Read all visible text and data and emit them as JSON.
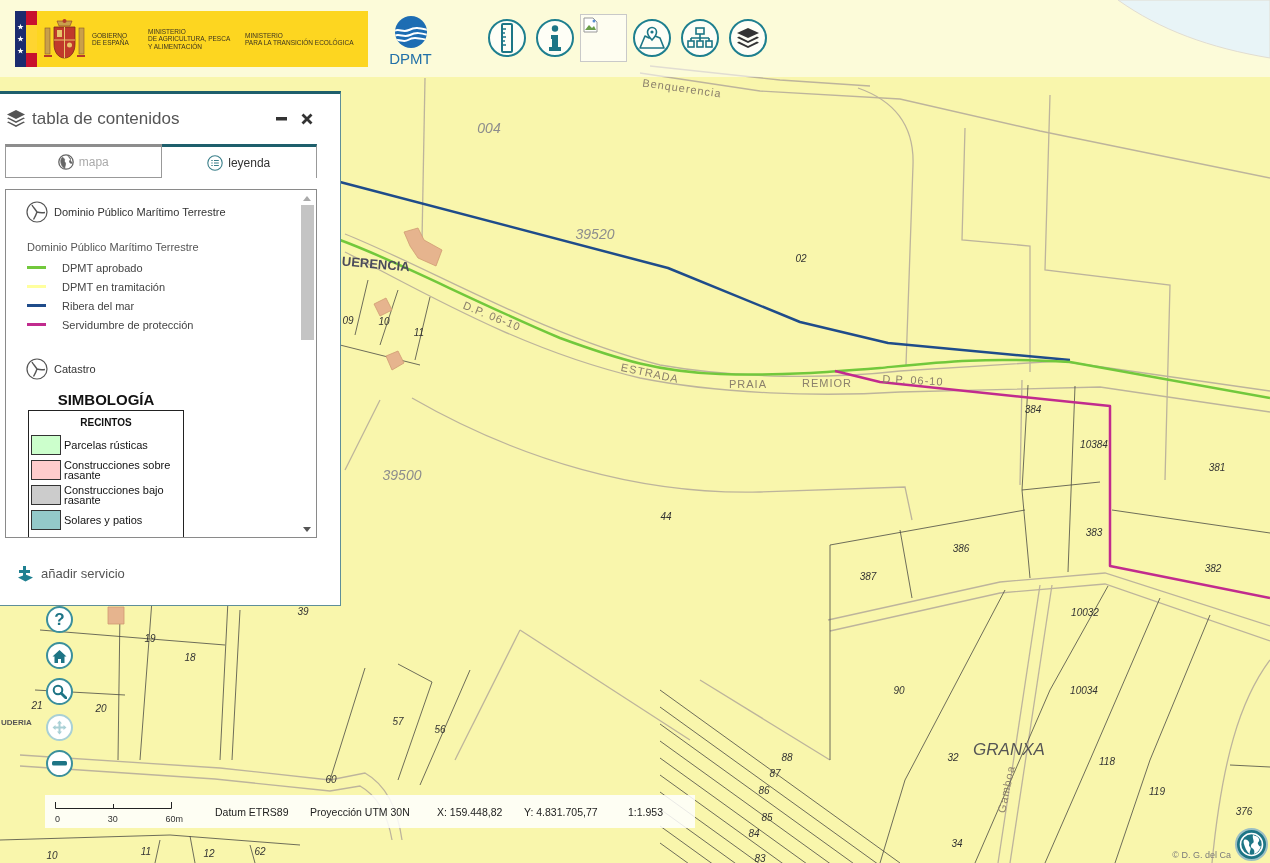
{
  "header": {
    "logo_texts": [
      [
        "GOBIERNO",
        "DE ESPAÑA"
      ],
      [
        "MINISTERIO",
        "DE AGRICULTURA, PESCA",
        "Y ALIMENTACIÓN"
      ],
      [
        "MINISTERIO",
        "PARA LA TRANSICIÓN ECOLÓGICA"
      ]
    ],
    "dpmt_label": "DPMT"
  },
  "panel": {
    "title": "tabla de contenidos",
    "tabs": [
      {
        "label": "mapa",
        "selected": false
      },
      {
        "label": "leyenda",
        "selected": true
      }
    ],
    "services": [
      {
        "kind": "lines",
        "name": "Dominio Público Marítimo Terrestre",
        "layer_title": "Dominio Público Marítimo Terrestre",
        "entries": [
          {
            "label": "DPMT aprobado",
            "color": "#72c83c"
          },
          {
            "label": "DPMT en tramitación",
            "color": "#ffff9e"
          },
          {
            "label": "Ribera del mar",
            "color": "#1f4c8a"
          },
          {
            "label": "Servidumbre de protección",
            "color": "#c12b8e"
          }
        ]
      },
      {
        "kind": "table",
        "name": "Catastro",
        "title": "SIMBOLOGÍA",
        "heading": "RECINTOS",
        "entries": [
          {
            "label": "Parcelas rústicas",
            "color": "#ccffcc"
          },
          {
            "label": "Construcciones sobre rasante",
            "color": "#ffcccc"
          },
          {
            "label": "Construcciones bajo rasante",
            "color": "#cccccc"
          },
          {
            "label": "Solares y patios",
            "color": "#93c8c8"
          }
        ]
      }
    ],
    "add_service": "añadir servicio"
  },
  "map_tools": [
    {
      "label": "?",
      "disabled": false
    },
    {
      "disabled": false
    },
    {
      "disabled": false
    },
    {
      "disabled": true
    },
    {
      "disabled": false
    }
  ],
  "status_bar": {
    "scale_labels": [
      "0",
      "30",
      "60m"
    ],
    "datum": "Datum ETRS89",
    "projection": "Proyección UTM 30N",
    "x": "X: 159.448,82",
    "y": "Y: 4.831.705,77",
    "scale": "1:1.953"
  },
  "map": {
    "labels": [
      {
        "text": "Benquerencia",
        "kind": "road"
      },
      {
        "text": "004",
        "kind": "block"
      },
      {
        "text": "39520",
        "kind": "block"
      },
      {
        "text": "02",
        "kind": "parcel"
      },
      {
        "text": "UERENCIA",
        "kind": "place"
      },
      {
        "text": "09",
        "kind": "parcel"
      },
      {
        "text": "10",
        "kind": "parcel"
      },
      {
        "text": "11",
        "kind": "parcel"
      },
      {
        "text": "D.P. 06-10",
        "kind": "road"
      },
      {
        "text": "ESTRADA",
        "kind": "road"
      },
      {
        "text": "PRAIA",
        "kind": "road"
      },
      {
        "text": "REMIOR",
        "kind": "road"
      },
      {
        "text": "D.P. 06-10",
        "kind": "road"
      },
      {
        "text": "384",
        "kind": "parcel"
      },
      {
        "text": "10384",
        "kind": "parcel"
      },
      {
        "text": "381",
        "kind": "parcel"
      },
      {
        "text": "39500",
        "kind": "block"
      },
      {
        "text": "44",
        "kind": "parcel"
      },
      {
        "text": "383",
        "kind": "parcel"
      },
      {
        "text": "386",
        "kind": "parcel"
      },
      {
        "text": "382",
        "kind": "parcel"
      },
      {
        "text": "387",
        "kind": "parcel"
      },
      {
        "text": "39",
        "kind": "parcel"
      },
      {
        "text": "10032",
        "kind": "parcel"
      },
      {
        "text": "19",
        "kind": "parcel"
      },
      {
        "text": "18",
        "kind": "parcel"
      },
      {
        "text": "90",
        "kind": "parcel"
      },
      {
        "text": "10034",
        "kind": "parcel"
      },
      {
        "text": "21",
        "kind": "parcel"
      },
      {
        "text": "20",
        "kind": "parcel"
      },
      {
        "text": "57",
        "kind": "parcel"
      },
      {
        "text": "UDERIA",
        "kind": "street"
      },
      {
        "text": "56",
        "kind": "parcel"
      },
      {
        "text": "GRANXA",
        "kind": "area"
      },
      {
        "text": "88",
        "kind": "parcel"
      },
      {
        "text": "32",
        "kind": "parcel"
      },
      {
        "text": "118",
        "kind": "parcel"
      },
      {
        "text": "87",
        "kind": "parcel"
      },
      {
        "text": "60",
        "kind": "parcel"
      },
      {
        "text": "86",
        "kind": "parcel"
      },
      {
        "text": "Gamboa",
        "kind": "road"
      },
      {
        "text": "119",
        "kind": "parcel"
      },
      {
        "text": "376",
        "kind": "parcel"
      },
      {
        "text": "85",
        "kind": "parcel"
      },
      {
        "text": "84",
        "kind": "parcel"
      },
      {
        "text": "34",
        "kind": "parcel"
      },
      {
        "text": "10",
        "kind": "parcel"
      },
      {
        "text": "11",
        "kind": "parcel"
      },
      {
        "text": "12",
        "kind": "parcel"
      },
      {
        "text": "62",
        "kind": "parcel"
      },
      {
        "text": "83",
        "kind": "parcel"
      }
    ],
    "attribution": "© D. G. del Ca"
  }
}
